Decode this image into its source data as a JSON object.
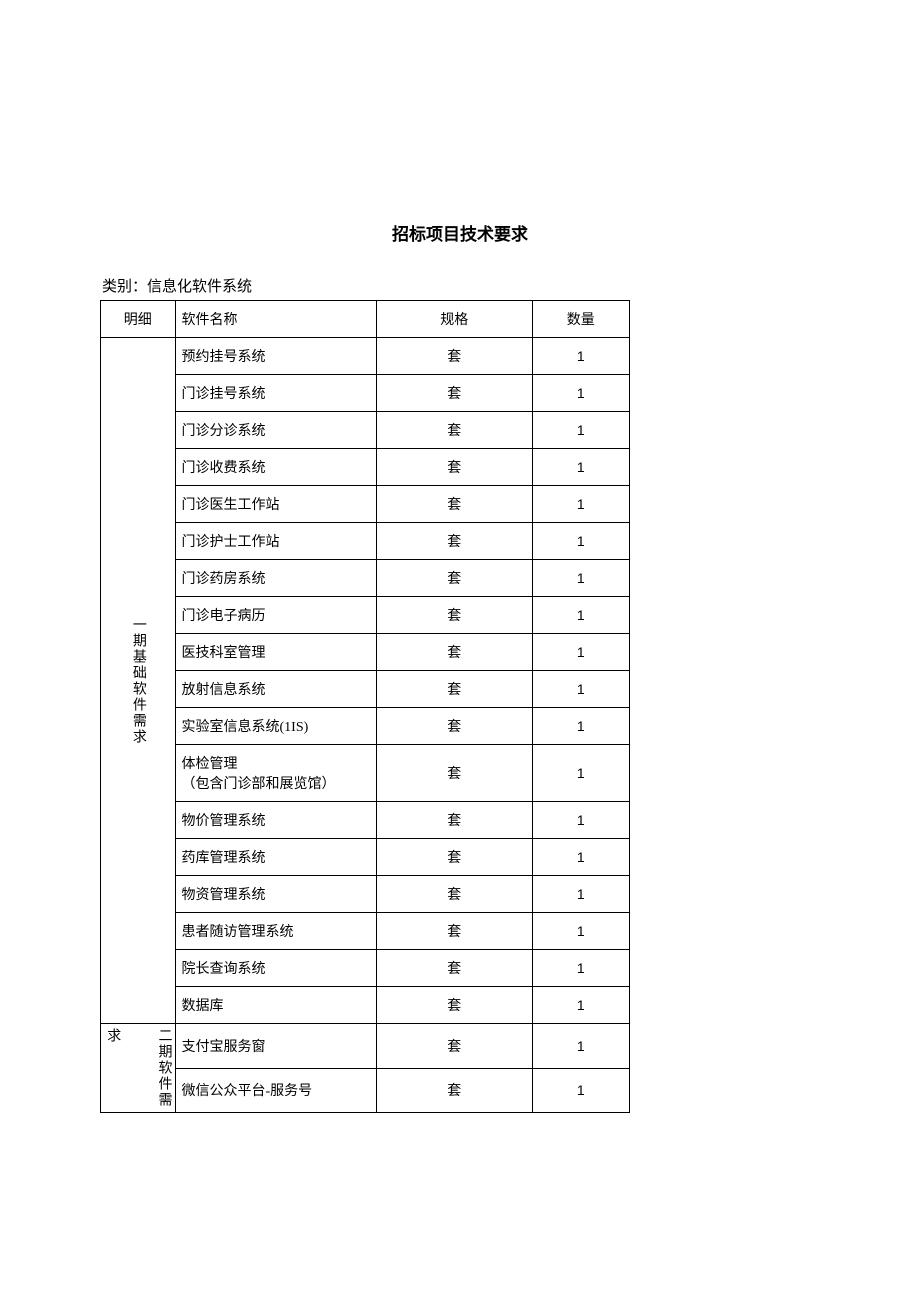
{
  "title": "招标项目技术要求",
  "category_line": "类别：信息化软件系统",
  "headers": {
    "detail": "明细",
    "name": "软件名称",
    "spec": "规格",
    "qty": "数量"
  },
  "groups": [
    {
      "label": "一期基础软件需求",
      "rows": [
        {
          "name": "预约挂号系统",
          "spec": "套",
          "qty": "1"
        },
        {
          "name": "门诊挂号系统",
          "spec": "套",
          "qty": "1"
        },
        {
          "name": "门诊分诊系统",
          "spec": "套",
          "qty": "1"
        },
        {
          "name": "门诊收费系统",
          "spec": "套",
          "qty": "1"
        },
        {
          "name": "门诊医生工作站",
          "spec": "套",
          "qty": "1"
        },
        {
          "name": "门诊护士工作站",
          "spec": "套",
          "qty": "1"
        },
        {
          "name": "门诊药房系统",
          "spec": "套",
          "qty": "1"
        },
        {
          "name": "门诊电子病历",
          "spec": "套",
          "qty": "1"
        },
        {
          "name": "医技科室管理",
          "spec": "套",
          "qty": "1"
        },
        {
          "name": "放射信息系统",
          "spec": "套",
          "qty": "1"
        },
        {
          "name": "实验室信息系统(1IS)",
          "spec": "套",
          "qty": "1"
        },
        {
          "name": "体检管理\n（包含门诊部和展览馆）",
          "spec": "套",
          "qty": "1"
        },
        {
          "name": "物价管理系统",
          "spec": "套",
          "qty": "1"
        },
        {
          "name": "药库管理系统",
          "spec": "套",
          "qty": "1"
        },
        {
          "name": "物资管理系统",
          "spec": "套",
          "qty": "1"
        },
        {
          "name": "患者随访管理系统",
          "spec": "套",
          "qty": "1"
        },
        {
          "name": "院长查询系统",
          "spec": "套",
          "qty": "1"
        },
        {
          "name": "数据库",
          "spec": "套",
          "qty": "1"
        }
      ]
    },
    {
      "label_left": "求",
      "label_right": "二期软件需",
      "rows": [
        {
          "name": "支付宝服务窗",
          "spec": "套",
          "qty": "1"
        },
        {
          "name": "微信公众平台-服务号",
          "spec": "套",
          "qty": "1"
        }
      ]
    }
  ]
}
